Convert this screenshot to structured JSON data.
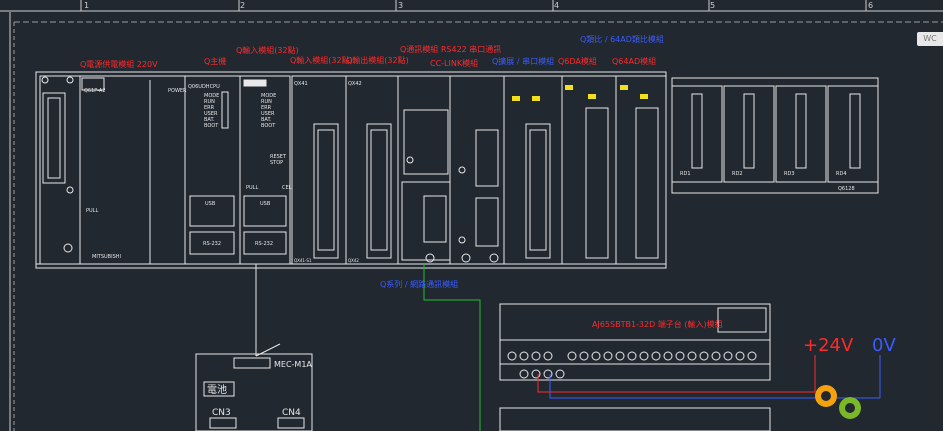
{
  "ruler": {
    "numbers": [
      "1",
      "2",
      "3",
      "4",
      "5",
      "6"
    ]
  },
  "side_button": "WC",
  "labels": {
    "power": "Q電源供電模組 220V",
    "cpu": "Q主機",
    "io32a": "Q輸入模組(32點)",
    "io32b": "Q輸入模組(32點)",
    "io32c": "Q輸出模組(32點)",
    "serial": "Q通訊模組 RS422 串口通訊",
    "cclink": "CC-LINK模組",
    "expand": "Q擴展 / 串口模組",
    "da": "Q6DA模組",
    "ad": "Q64AD模組",
    "analog_top": "Q類比 / 64AD類比模組",
    "bottom_net": "Q系列 / 網路通訊模組",
    "terminal_title": "AJ65SBTB1-32D 端子台 (輸入)模組",
    "mec": "MEC-M1A",
    "battery": "電池",
    "cn3": "CN3",
    "cn4": "CN4",
    "v24": "+24V",
    "v0": "0V"
  },
  "module_text": {
    "ps_model": "Q61P-A2",
    "ps_power": "POWER",
    "ps_pull": "PULL",
    "cpu_model": "Q06UDHCPU",
    "cpu_leds": [
      "MODE",
      "RUN",
      "ERR",
      "USER",
      "BAT.",
      "BOOT"
    ],
    "cpu_usb": "USB",
    "cpu_rs232": "RS-232",
    "cpu2_leds": [
      "MODE",
      "RUN",
      "ERR",
      "USER",
      "BAT.",
      "BOOT"
    ],
    "cpu2_usb": "USB",
    "cpu2_rs232": "RS-232",
    "cpu2_reset": "RESET",
    "cpu2_stop": "STOP",
    "cpu2_cel": "CEL",
    "cpu2_pull": "PULL",
    "in1_model": "QX41",
    "in2_model": "QX42",
    "in1_bottom": "QX41-S1",
    "in2_bottom": "QX42",
    "mitsubishi": "MITSUBISHI",
    "remote_labels": [
      "RD1",
      "RD2",
      "RD3",
      "RD4"
    ],
    "remote_last": "Q6128"
  },
  "colors": {
    "background": "#212830",
    "line": "#e8e8e8",
    "red": "#ff2a2a",
    "blue": "#3a5cff",
    "green": "#1fbf2a",
    "yellow": "#f0e020"
  }
}
